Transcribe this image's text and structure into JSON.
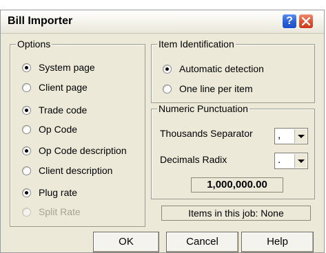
{
  "window": {
    "title": "Bill Importer"
  },
  "options": {
    "legend": "Options",
    "items": [
      {
        "label": "System page",
        "checked": true,
        "disabled": false
      },
      {
        "label": "Client page",
        "checked": false,
        "disabled": false
      },
      {
        "label": "Trade code",
        "checked": true,
        "disabled": false
      },
      {
        "label": "Op Code",
        "checked": false,
        "disabled": false
      },
      {
        "label": "Op Code description",
        "checked": true,
        "disabled": false
      },
      {
        "label": "Client description",
        "checked": false,
        "disabled": false
      },
      {
        "label": "Plug rate",
        "checked": true,
        "disabled": false
      },
      {
        "label": "Split Rate",
        "checked": false,
        "disabled": true
      }
    ]
  },
  "item_identification": {
    "legend": "Item Identification",
    "automatic_label": "Automatic detection",
    "one_line_label": "One line per item"
  },
  "numeric_punctuation": {
    "legend": "Numeric Punctuation",
    "thousands_label": "Thousands Separator",
    "thousands_value": ",",
    "decimals_label": "Decimals Radix",
    "decimals_value": ".",
    "sample": "1,000,000.00"
  },
  "status": {
    "text": "Items in this job: None"
  },
  "buttons": {
    "ok": "OK",
    "cancel": "Cancel",
    "help": "Help"
  }
}
